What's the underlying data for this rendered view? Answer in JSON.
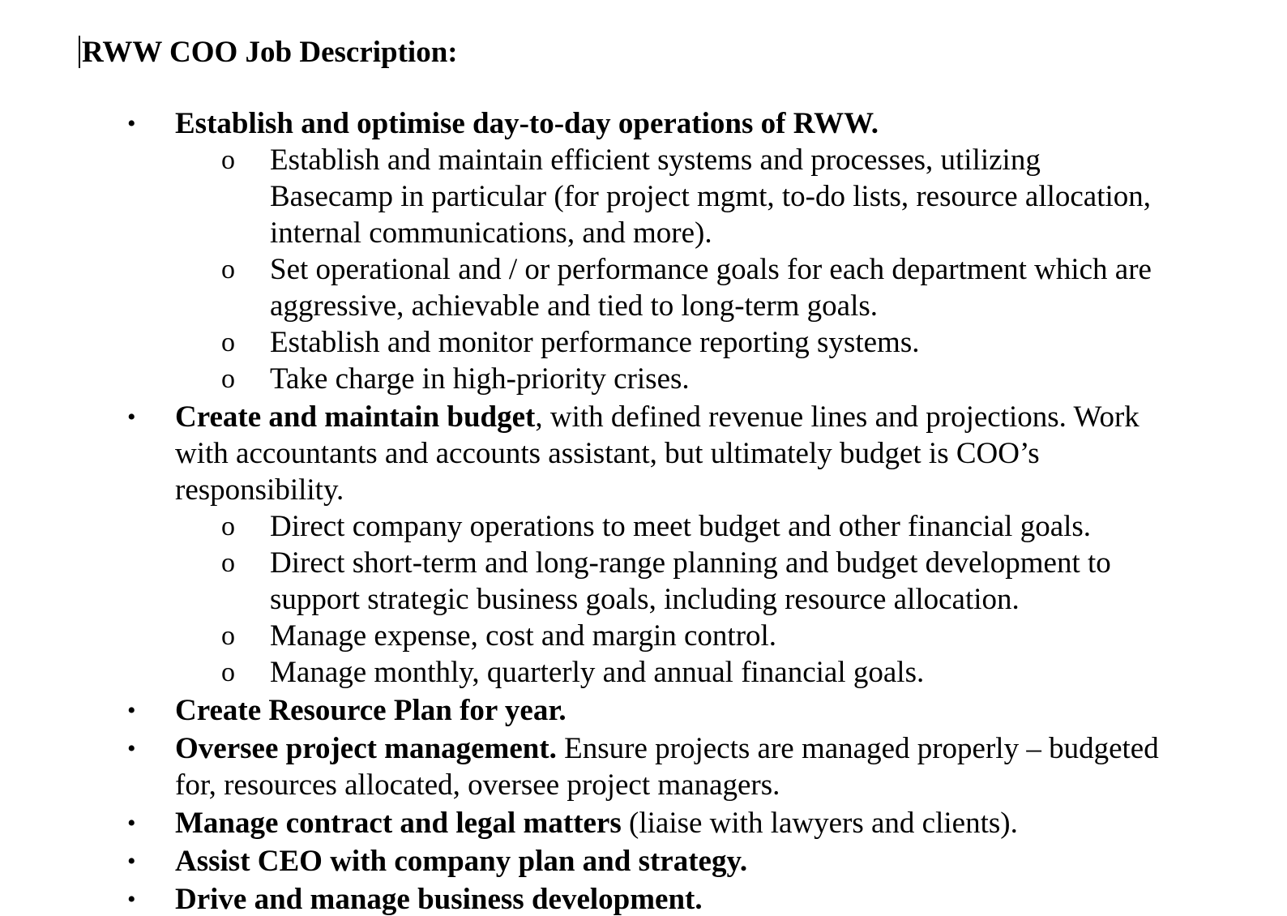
{
  "document": {
    "title": "RWW COO Job Description:",
    "bullet_symbol": "•",
    "sub_bullet_symbol": "o",
    "items": [
      {
        "bold": "Establish and optimise day-to-day operations of RWW.",
        "text": "",
        "subitems": [
          "Establish and maintain efficient systems and processes, utilizing Basecamp in particular (for project mgmt, to-do lists, resource allocation, internal communications, and more).",
          "Set operational and / or performance goals for each department which are aggressive, achievable and tied to long-term goals.",
          "Establish and monitor performance reporting systems.",
          "Take charge in high-priority crises."
        ]
      },
      {
        "bold": "Create and maintain budget",
        "text": ", with defined revenue lines and projections. Work with accountants and accounts assistant, but ultimately budget is COO’s responsibility.",
        "subitems": [
          "Direct company operations to meet budget and other financial goals.",
          "Direct short-term and long-range planning and budget development to support strategic business goals, including resource allocation.",
          "Manage expense, cost and margin control.",
          "Manage monthly, quarterly and annual financial goals."
        ]
      },
      {
        "bold": "Create Resource Plan for year.",
        "text": ""
      },
      {
        "bold": "Oversee project management.",
        "text": " Ensure projects are managed properly – budgeted for, resources allocated, oversee project managers."
      },
      {
        "bold": "Manage contract and legal matters",
        "text": " (liaise with lawyers and clients)."
      },
      {
        "bold": "Assist CEO with company plan and strategy.",
        "text": ""
      },
      {
        "bold": "Drive and manage business development.",
        "text": ""
      }
    ]
  }
}
